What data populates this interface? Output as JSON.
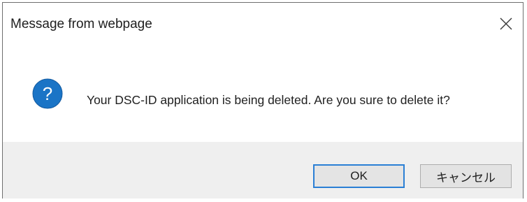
{
  "dialog": {
    "title": "Message from webpage",
    "message": "Your DSC-ID application is being deleted.  Are you sure to delete it?",
    "icon": "question-icon",
    "accent_color": "#1a74c6",
    "buttons": {
      "ok_label": "OK",
      "cancel_label": "キャンセル"
    }
  }
}
